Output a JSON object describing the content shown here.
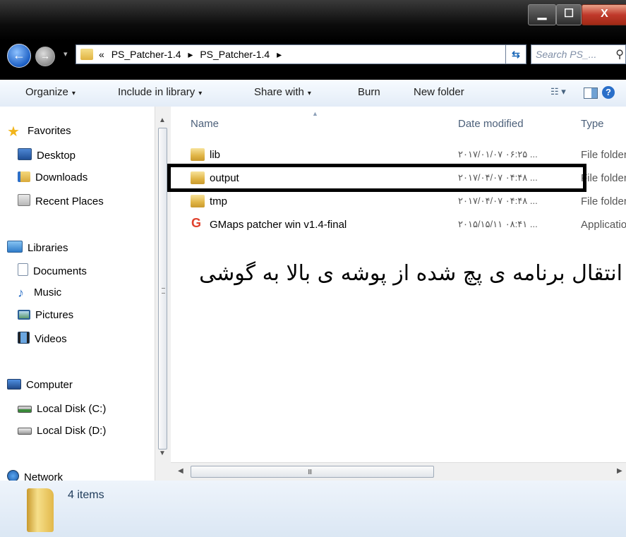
{
  "window": {
    "minimize_icon": "minimize-icon",
    "maximize_icon": "maximize-icon",
    "close_label": "X"
  },
  "nav": {
    "back_icon": "back-arrow-icon",
    "forward_icon": "forward-arrow-icon",
    "breadcrumb": {
      "overflow": "«",
      "crumbs": [
        "PS_Patcher-1.4",
        "PS_Patcher-1.4"
      ],
      "separator": "▸"
    },
    "search_placeholder": "Search PS_...",
    "search_icon": "search-icon"
  },
  "toolbar": {
    "organize": "Organize",
    "include_in_library": "Include in library",
    "share_with": "Share with",
    "burn": "Burn",
    "new_folder": "New folder",
    "caret": "▾"
  },
  "sidebar": {
    "favorites": {
      "label": "Favorites",
      "items": [
        "Desktop",
        "Downloads",
        "Recent Places"
      ]
    },
    "libraries": {
      "label": "Libraries",
      "items": [
        "Documents",
        "Music",
        "Pictures",
        "Videos"
      ]
    },
    "computer": {
      "label": "Computer",
      "items": [
        "Local Disk (C:)",
        "Local Disk (D:)"
      ]
    },
    "network": {
      "label": "Network"
    }
  },
  "columns": {
    "name": "Name",
    "date_modified": "Date modified",
    "type": "Type"
  },
  "files": [
    {
      "name": "lib",
      "date": "۲۰۱۷/۰۱/۰۷ ۰۶:۲۵ ...",
      "type": "File folder",
      "icon": "folder-icon"
    },
    {
      "name": "output",
      "date": "۲۰۱۷/۰۴/۰۷ ۰۴:۴۸ ...",
      "type": "File folder",
      "icon": "folder-icon"
    },
    {
      "name": "tmp",
      "date": "۲۰۱۷/۰۴/۰۷ ۰۴:۴۸ ...",
      "type": "File folder",
      "icon": "folder-icon"
    },
    {
      "name": "GMaps patcher win v1.4-final",
      "date": "۲۰۱۵/۱۵/۱۱ ۰۸:۴۱ ...",
      "type": "Application",
      "icon": "gmaps-app-icon"
    }
  ],
  "annotation": "انتقال برنامه ی پچ شده از پوشه ی بالا به گوشی",
  "status": {
    "item_count": "4 items"
  }
}
